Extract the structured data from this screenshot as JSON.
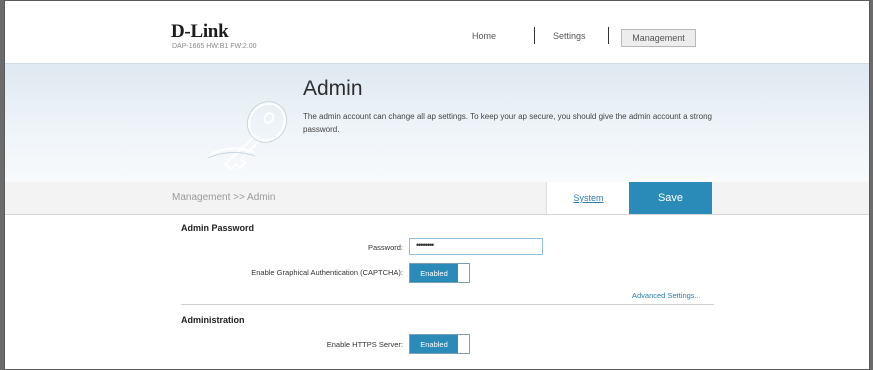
{
  "header": {
    "brand": "D-Link",
    "model": "DAP-1665 HW:B1 FW:2.00",
    "nav": {
      "home": "Home",
      "settings": "Settings",
      "management": "Management"
    }
  },
  "banner": {
    "title": "Admin",
    "description": "The admin account can change all ap settings. To keep your ap secure, you should give the admin account a strong password."
  },
  "toolbar": {
    "breadcrumb": "Management >> Admin",
    "system_link": "System",
    "save_label": "Save"
  },
  "admin_password": {
    "section_title": "Admin Password",
    "password_label": "Password:",
    "password_value": "••••••••",
    "captcha_label": "Enable Graphical Authentication (CAPTCHA):",
    "captcha_state": "Enabled",
    "advanced_link": "Advanced Settings..."
  },
  "administration": {
    "section_title": "Administration",
    "https_label": "Enable HTTPS Server:",
    "https_state": "Enabled"
  },
  "colors": {
    "accent": "#2a8ab8",
    "link": "#2a7fb0",
    "banner_bg": "#e6eef4"
  }
}
